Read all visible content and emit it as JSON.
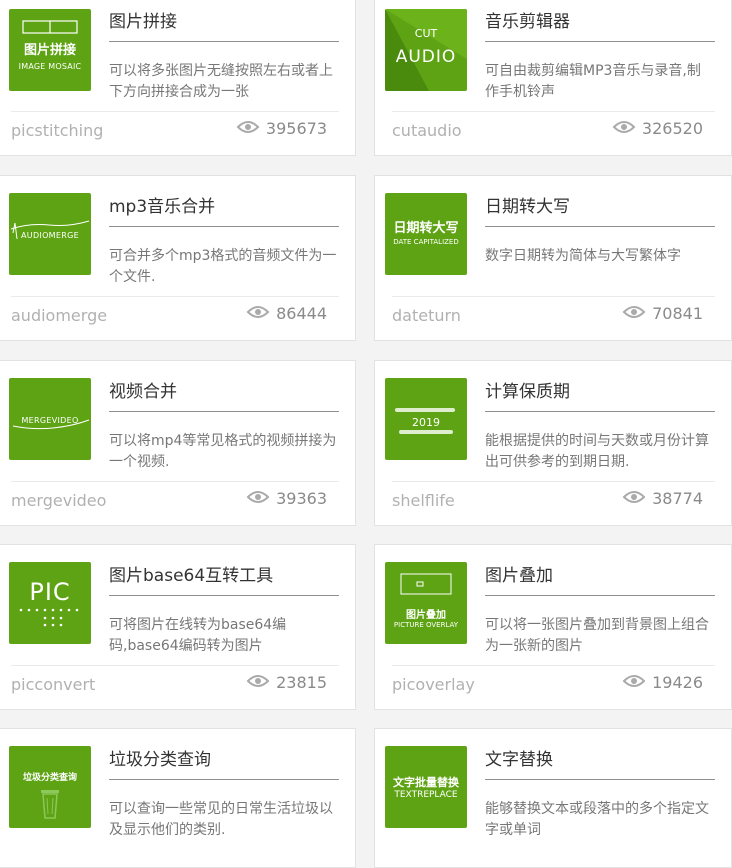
{
  "cards": [
    {
      "title": "图片拼接",
      "desc": "可以将多张图片无缝按照左右或者上下方向拼接合成为一张",
      "slug": "picstitching",
      "views": "395673",
      "thumb_line1": "图片拼接",
      "thumb_line2": "IMAGE MOSAIC"
    },
    {
      "title": "音乐剪辑器",
      "desc": "可自由裁剪编辑MP3音乐与录音,制作手机铃声",
      "slug": "cutaudio",
      "views": "326520",
      "thumb_line1": "CUT",
      "thumb_line2": "AUDIO"
    },
    {
      "title": "mp3音乐合并",
      "desc": "可合并多个mp3格式的音频文件为一个文件.",
      "slug": "audiomerge",
      "views": "86444",
      "thumb_line1": "AUDIOMERGE"
    },
    {
      "title": "日期转大写",
      "desc": "数字日期转为简体与大写繁体字",
      "slug": "dateturn",
      "views": "70841",
      "thumb_line1": "日期转大写",
      "thumb_line2": "DATE CAPITALIZED"
    },
    {
      "title": "视频合并",
      "desc": "可以将mp4等常见格式的视频拼接为一个视频.",
      "slug": "mergevideo",
      "views": "39363",
      "thumb_line1": "MERGEVIDEO"
    },
    {
      "title": "计算保质期",
      "desc": "能根据提供的时间与天数或月份计算出可供参考的到期日期.",
      "slug": "shelflife",
      "views": "38774",
      "thumb_line1": "2019"
    },
    {
      "title": "图片base64互转工具",
      "desc": "可将图片在线转为base64编码,base64编码转为图片",
      "slug": "picconvert",
      "views": "23815",
      "thumb_line1": "PIC"
    },
    {
      "title": "图片叠加",
      "desc": "可以将一张图片叠加到背景图上组合为一张新的图片",
      "slug": "picoverlay",
      "views": "19426",
      "thumb_line1": "图片叠加",
      "thumb_line2": "PICTURE OVERLAY"
    },
    {
      "title": "垃圾分类查询",
      "desc": "可以查询一些常见的日常生活垃圾以及显示他们的类别.",
      "thumb_line1": "垃圾分类查询"
    },
    {
      "title": "文字替换",
      "desc": "能够替换文本或段落中的多个指定文字或单词",
      "thumb_line1": "文字批量替换",
      "thumb_line2": "TEXTREPLACE"
    }
  ],
  "colors": {
    "thumb_green": "#5ea313"
  }
}
